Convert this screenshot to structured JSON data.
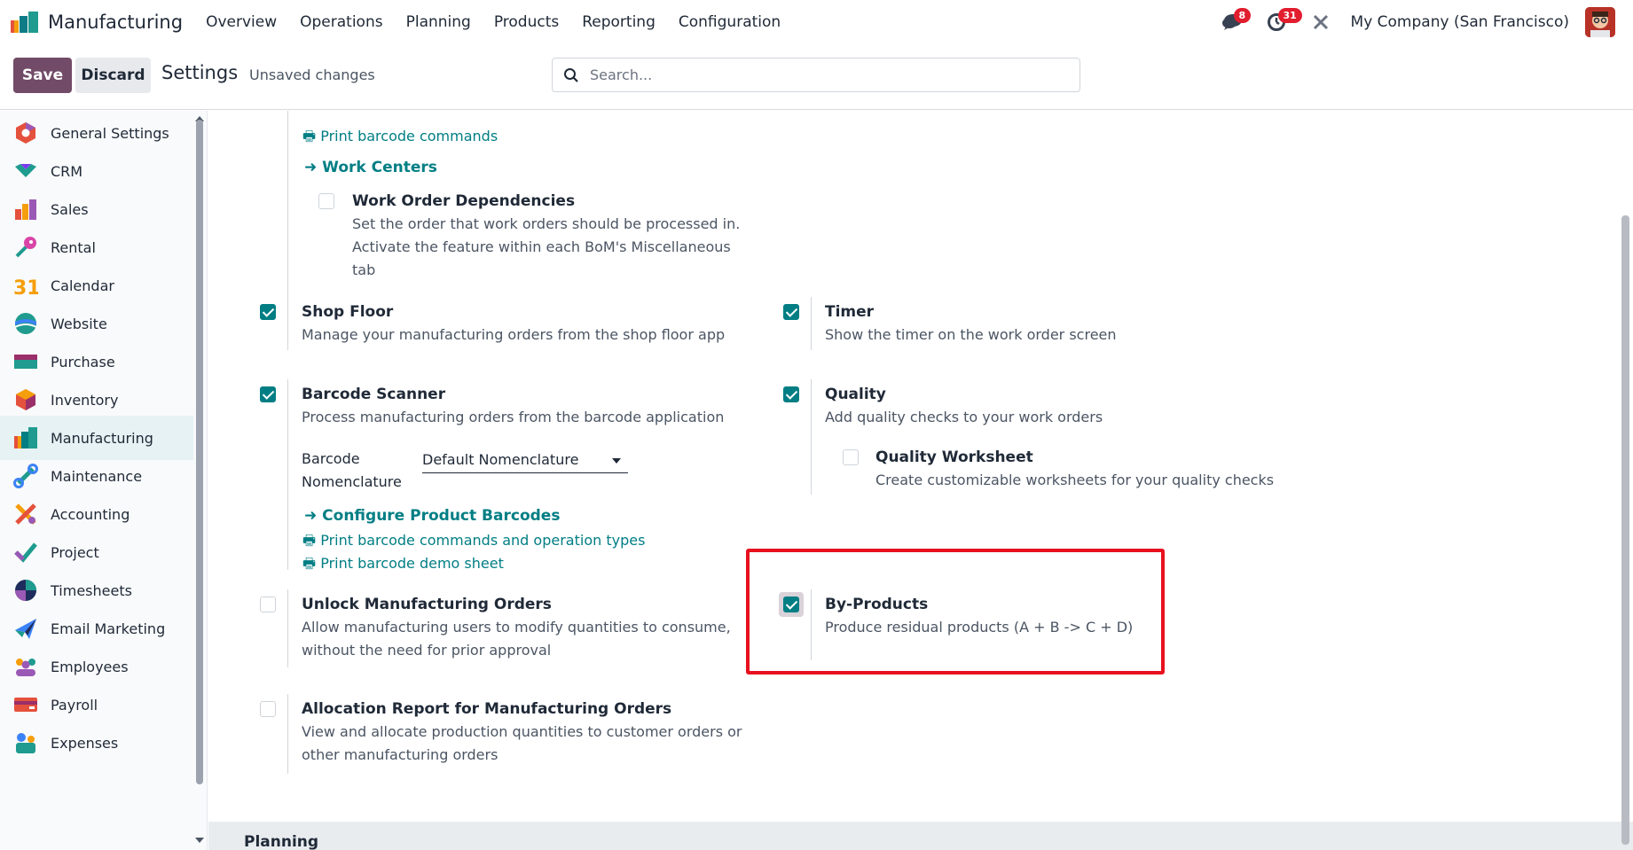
{
  "navbar": {
    "app_name": "Manufacturing",
    "menu": [
      "Overview",
      "Operations",
      "Planning",
      "Products",
      "Reporting",
      "Configuration"
    ],
    "messages_badge": "8",
    "activities_badge": "31",
    "company": "My Company (San Francisco)"
  },
  "control_panel": {
    "save_label": "Save",
    "discard_label": "Discard",
    "title": "Settings",
    "status": "Unsaved changes",
    "search_placeholder": "Search..."
  },
  "sidebar": {
    "items": [
      {
        "label": "General Settings",
        "icon": "general-settings-icon"
      },
      {
        "label": "CRM",
        "icon": "crm-icon"
      },
      {
        "label": "Sales",
        "icon": "sales-icon"
      },
      {
        "label": "Rental",
        "icon": "rental-icon"
      },
      {
        "label": "Calendar",
        "icon": "calendar-icon"
      },
      {
        "label": "Website",
        "icon": "website-icon"
      },
      {
        "label": "Purchase",
        "icon": "purchase-icon"
      },
      {
        "label": "Inventory",
        "icon": "inventory-icon"
      },
      {
        "label": "Manufacturing",
        "icon": "manufacturing-icon"
      },
      {
        "label": "Maintenance",
        "icon": "maintenance-icon"
      },
      {
        "label": "Accounting",
        "icon": "accounting-icon"
      },
      {
        "label": "Project",
        "icon": "project-icon"
      },
      {
        "label": "Timesheets",
        "icon": "timesheets-icon"
      },
      {
        "label": "Email Marketing",
        "icon": "email-marketing-icon"
      },
      {
        "label": "Employees",
        "icon": "employees-icon"
      },
      {
        "label": "Payroll",
        "icon": "payroll-icon"
      },
      {
        "label": "Expenses",
        "icon": "expenses-icon"
      }
    ],
    "active": "Manufacturing",
    "calendar_day": "31"
  },
  "main": {
    "print_barcode_commands": "Print barcode commands",
    "work_centers": "Work Centers",
    "work_order_dependencies": {
      "title": "Work Order Dependencies",
      "desc_lines": [
        "Set the order that work orders should be processed in.",
        "Activate the feature within each BoM's Miscellaneous",
        "tab"
      ],
      "checked": false
    },
    "shop_floor": {
      "title": "Shop Floor",
      "desc": "Manage your manufacturing orders from the shop floor app",
      "checked": true
    },
    "timer": {
      "title": "Timer",
      "desc": "Show the timer on the work order screen",
      "checked": true
    },
    "barcode_scanner": {
      "title": "Barcode Scanner",
      "desc": "Process manufacturing orders from the barcode application",
      "checked": true
    },
    "barcode_nomenclature": {
      "label_line1": "Barcode",
      "label_line2": "Nomenclature",
      "value": "Default Nomenclature"
    },
    "configure_product_barcodes": "Configure Product Barcodes",
    "print_barcode_commands_ops": "Print barcode commands and operation types",
    "print_barcode_demo": "Print barcode demo sheet",
    "quality": {
      "title": "Quality",
      "desc": "Add quality checks to your work orders",
      "checked": true
    },
    "quality_worksheet": {
      "title": "Quality Worksheet",
      "desc": "Create customizable worksheets for your quality checks",
      "checked": false
    },
    "unlock_mo": {
      "title": "Unlock Manufacturing Orders",
      "desc_lines": [
        "Allow manufacturing users to modify quantities to consume,",
        "without the need for prior approval"
      ],
      "checked": false
    },
    "by_products": {
      "title": "By-Products",
      "desc": "Produce residual products (A + B -> C + D)",
      "checked": true
    },
    "allocation_report": {
      "title": "Allocation Report for Manufacturing Orders",
      "desc_lines": [
        "View and allocate production quantities to customer orders or",
        "other manufacturing orders"
      ],
      "checked": false
    },
    "next_section": "Planning"
  },
  "colors": {
    "primary": "#714b67",
    "accent": "#017e84",
    "highlight": "#e8101e"
  }
}
